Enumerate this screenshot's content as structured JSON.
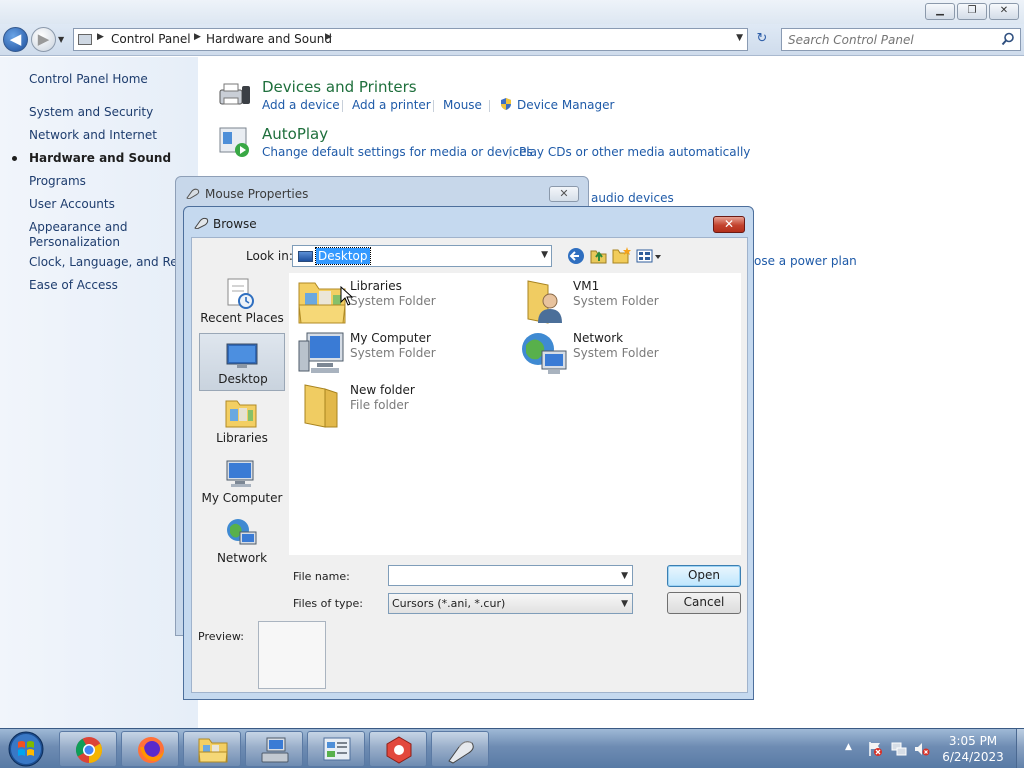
{
  "window": {
    "minimize_glyph": "▁",
    "maximize_glyph": "❐",
    "close_glyph": "✕"
  },
  "nav": {
    "back_glyph": "◀",
    "forward_glyph": "▶",
    "recent_glyph": "▼",
    "breadcrumbs": [
      "Control Panel",
      "Hardware and Sound"
    ],
    "arrow_glyph": "▶",
    "dropdown_glyph": "▼",
    "refresh_glyph": "↻",
    "search_placeholder": "Search Control Panel"
  },
  "sidebar": {
    "home": "Control Panel Home",
    "items": [
      "System and Security",
      "Network and Internet",
      "Hardware and Sound",
      "Programs",
      "User Accounts",
      "Appearance and",
      "Personalization",
      "Clock, Language, and Regio",
      "Ease of Access"
    ]
  },
  "categories": {
    "devices": {
      "title": "Devices and Printers",
      "links": [
        "Add a device",
        "Add a printer",
        "Mouse",
        "Device Manager"
      ]
    },
    "autoplay": {
      "title": "AutoPlay",
      "links": [
        "Change default settings for media or devices",
        "Play CDs or other media automatically"
      ]
    },
    "sound_fragment": "audio devices",
    "power_fragment": "ose a power plan"
  },
  "mouse_properties": {
    "title": "Mouse Properties",
    "close_glyph": "✕"
  },
  "browse": {
    "title": "Browse",
    "close_glyph": "✕",
    "look_in_label": "Look in:",
    "look_in_value": "Desktop",
    "places": [
      "Recent Places",
      "Desktop",
      "Libraries",
      "My Computer",
      "Network"
    ],
    "files": [
      {
        "name": "Libraries",
        "type": "System Folder"
      },
      {
        "name": "VM1",
        "type": "System Folder"
      },
      {
        "name": "My Computer",
        "type": "System Folder"
      },
      {
        "name": "Network",
        "type": "System Folder"
      },
      {
        "name": "New folder",
        "type": "File folder"
      }
    ],
    "file_name_label": "File name:",
    "file_name_value": "",
    "files_of_type_label": "Files of type:",
    "files_of_type_value": "Cursors (*.ani, *.cur)",
    "open_label": "Open",
    "cancel_label": "Cancel",
    "preview_label": "Preview:"
  },
  "taskbar": {
    "tray_arrow_glyph": "▲",
    "time": "3:05 PM",
    "date": "6/24/2023"
  },
  "colors": {
    "link": "#1e5aa8",
    "category_title": "#1e6f3c",
    "selection": "#3399ff"
  }
}
